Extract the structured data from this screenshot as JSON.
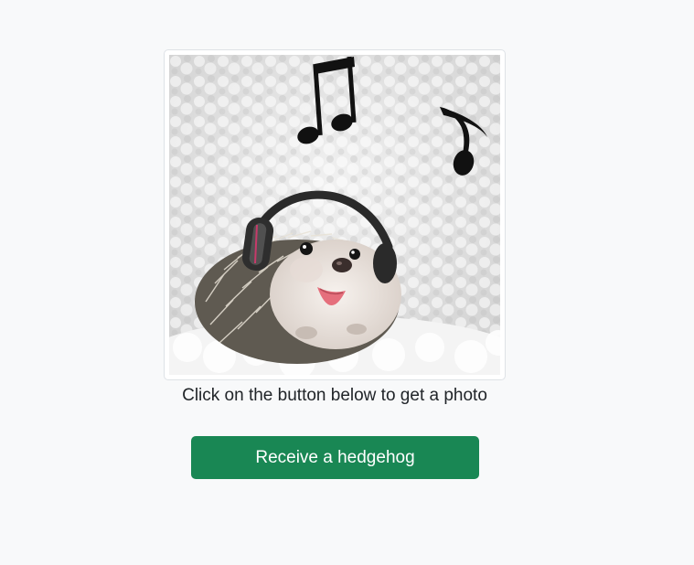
{
  "photo": {
    "subject": "hedgehog wearing headphones"
  },
  "caption": "Click on the button below to get a photo",
  "button": {
    "label": "Receive a hedgehog"
  },
  "colors": {
    "page_background": "#f8f9fa",
    "button_background": "#198754",
    "button_text": "#ffffff",
    "caption_text": "#212529",
    "frame_border": "#dee2e6"
  }
}
